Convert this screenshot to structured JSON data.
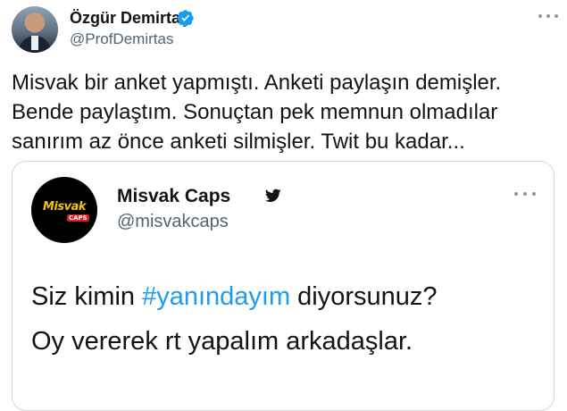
{
  "author": {
    "name": "Özgür Demirtaş",
    "handle": "@ProfDemirtas",
    "verified": true
  },
  "tweet": {
    "lines": [
      "Misvak bir anket yapmıştı. Anketi paylaşın demişler.",
      "Bende paylaştım. Sonuçtan pek memnun olmadılar",
      "sanırım az önce anketi silmişler. Twit bu kadar..."
    ]
  },
  "quoted": {
    "name": "Misvak Caps",
    "handle": "@misvakcaps",
    "avatar_text": "Misvak",
    "avatar_subtext": "CAPS",
    "line1_before": "Siz kimin ",
    "line1_hashtag": "#yanındayım",
    "line1_after": " diyorsunuz?",
    "line2": "Oy vererek rt yapalım arkadaşlar."
  },
  "colors": {
    "link": "#1d9bf0",
    "text": "#0f1419",
    "muted": "#536471",
    "border": "#cfd9de"
  },
  "icons": [
    "verified-badge-icon",
    "more-options-icon",
    "twitter-bird-icon"
  ]
}
